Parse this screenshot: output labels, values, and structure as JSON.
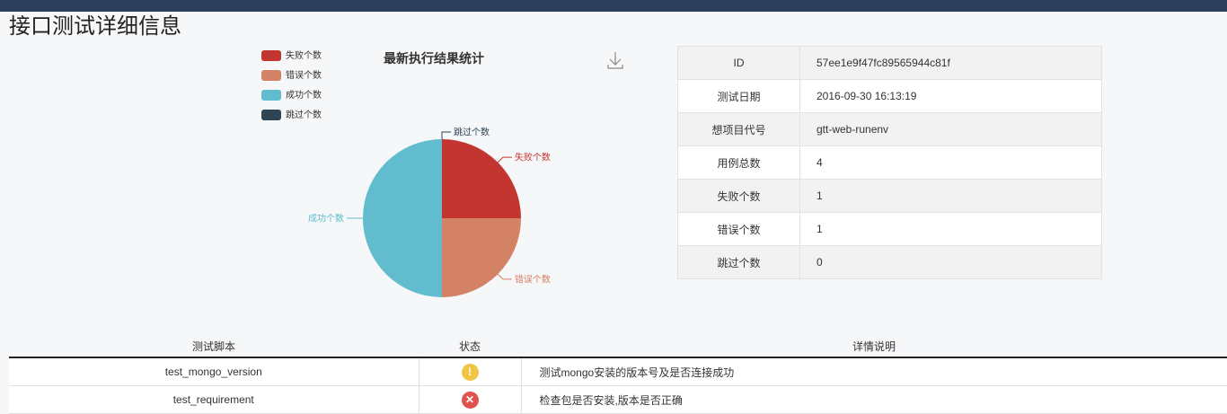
{
  "page": {
    "title": "接口测试详细信息"
  },
  "chart_data": {
    "type": "pie",
    "title": "最新执行结果统计",
    "categories": [
      "失败个数",
      "错误个数",
      "成功个数",
      "跳过个数"
    ],
    "values": [
      1,
      1,
      2,
      0
    ],
    "colors": [
      "#c23531",
      "#d48265",
      "#61bdcd",
      "#2f4554"
    ],
    "legend": "top-left",
    "download_icon": "download-icon"
  },
  "info": {
    "rows": [
      {
        "key": "ID",
        "value": "57ee1e9f47fc89565944c81f"
      },
      {
        "key": "测试日期",
        "value": "2016-09-30 16:13:19"
      },
      {
        "key": "想项目代号",
        "value": "gtt-web-runenv"
      },
      {
        "key": "用例总数",
        "value": "4"
      },
      {
        "key": "失败个数",
        "value": "1"
      },
      {
        "key": "错误个数",
        "value": "1"
      },
      {
        "key": "跳过个数",
        "value": "0"
      }
    ]
  },
  "results": {
    "headers": [
      "测试脚本",
      "状态",
      "详情说明"
    ],
    "rows": [
      {
        "script": "test_mongo_version",
        "status_icon": "warning-icon",
        "status_symbol": "!",
        "status_color": "#f0c543",
        "detail": "测试mongo安装的版本号及是否连接成功"
      },
      {
        "script": "test_requirement",
        "status_icon": "error-icon",
        "status_symbol": "✕",
        "status_color": "#e0524c",
        "detail": "检查包是否安装,版本是否正确"
      }
    ]
  }
}
